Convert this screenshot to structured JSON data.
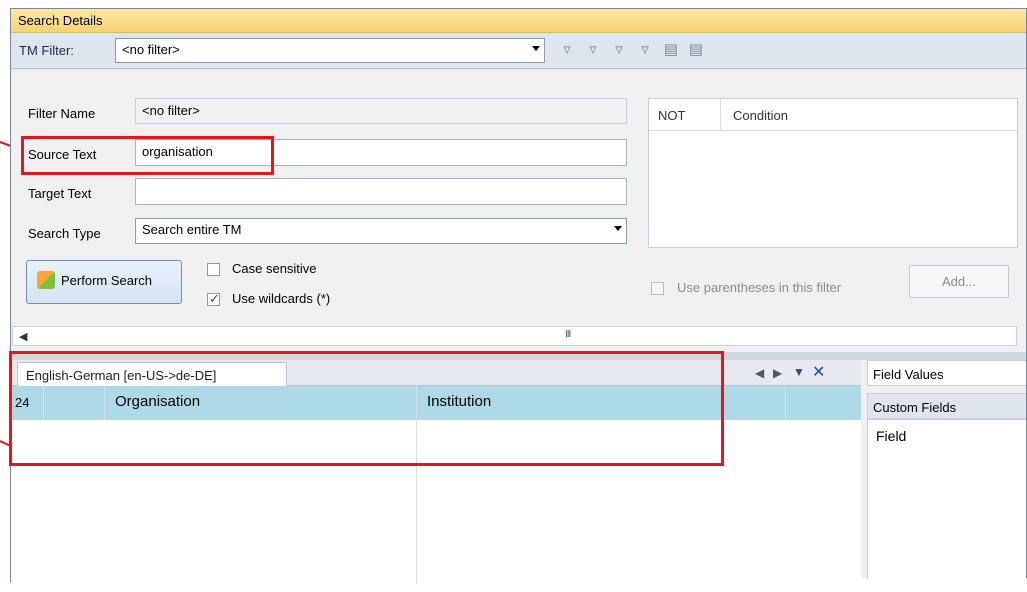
{
  "window": {
    "title": "Search Details"
  },
  "toolbar": {
    "tm_filter_label": "TM Filter:",
    "filter_value": "<no filter>",
    "icons": [
      "add-filter-icon",
      "edit-filter-icon",
      "copy-filter-icon",
      "delete-filter-icon",
      "import-filter-icon",
      "export-filter-icon"
    ]
  },
  "form": {
    "filter_name_label": "Filter Name",
    "filter_name_value": "<no filter>",
    "source_text_label": "Source Text",
    "source_text_value": "organisation",
    "target_text_label": "Target Text",
    "target_text_value": "",
    "search_type_label": "Search Type",
    "search_type_value": "Search entire TM",
    "perform_search_label": "Perform Search",
    "case_sensitive_label": "Case sensitive",
    "case_sensitive_checked": false,
    "use_wildcards_label": "Use wildcards (*)",
    "use_wildcards_checked": true
  },
  "conditions": {
    "columns": [
      "NOT",
      "Condition"
    ],
    "use_parentheses_label": "Use parentheses in this filter",
    "add_label": "Add..."
  },
  "scrollbar": {
    "grip": "III"
  },
  "results": {
    "tab_label": "English-German [en-US->de-DE]",
    "rows": [
      {
        "id": "24",
        "source": "Organisation",
        "target": "Institution"
      }
    ]
  },
  "right_panel": {
    "header": "Field Values",
    "subheader": "Custom Fields",
    "column": "Field"
  },
  "colors": {
    "annotation": "#e8141c",
    "title_bar": "#f7d274",
    "selected_row": "#aed9e6"
  }
}
